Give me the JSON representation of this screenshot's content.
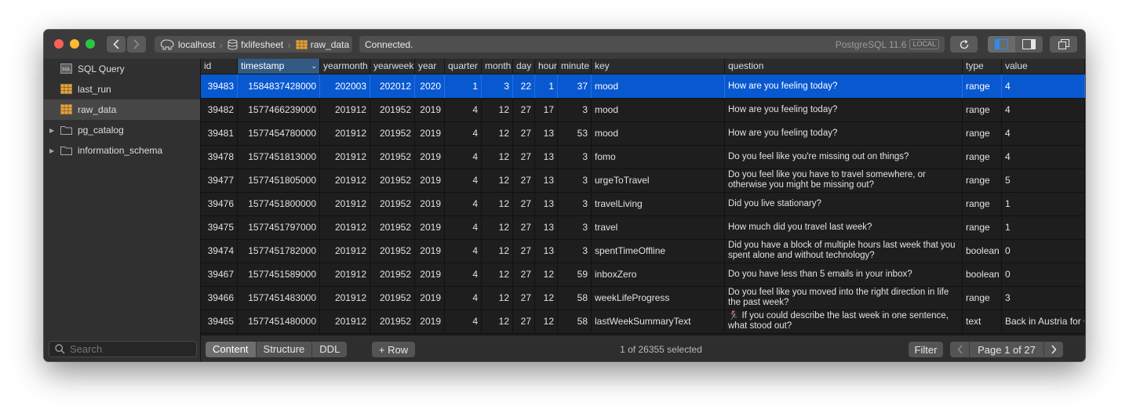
{
  "breadcrumbs": [
    "localhost",
    "fxlifesheet",
    "raw_data"
  ],
  "status_text": "Connected.",
  "db_label": "PostgreSQL 11.6",
  "db_badge": "LOCAL",
  "sidebar": {
    "items": [
      {
        "label": "SQL Query",
        "icon": "sql-file-icon"
      },
      {
        "label": "last_run",
        "icon": "table-icon"
      },
      {
        "label": "raw_data",
        "icon": "table-icon",
        "selected": true
      },
      {
        "label": "pg_catalog",
        "icon": "folder-icon"
      },
      {
        "label": "information_schema",
        "icon": "folder-icon"
      }
    ],
    "search_placeholder": "Search"
  },
  "columns": [
    "id",
    "timestamp",
    "yearmonth",
    "yearweek",
    "year",
    "quarter",
    "month",
    "day",
    "hour",
    "minute",
    "key",
    "question",
    "type",
    "value"
  ],
  "sorted_column": "timestamp",
  "rows": [
    [
      "39483",
      "1584837428000",
      "202003",
      "202012",
      "2020",
      "1",
      "3",
      "22",
      "1",
      "37",
      "mood",
      "How are you feeling today?",
      "range",
      "4"
    ],
    [
      "39482",
      "1577466239000",
      "201912",
      "201952",
      "2019",
      "4",
      "12",
      "27",
      "17",
      "3",
      "mood",
      "How are you feeling today?",
      "range",
      "4"
    ],
    [
      "39481",
      "1577454780000",
      "201912",
      "201952",
      "2019",
      "4",
      "12",
      "27",
      "13",
      "53",
      "mood",
      "How are you feeling today?",
      "range",
      "4"
    ],
    [
      "39478",
      "1577451813000",
      "201912",
      "201952",
      "2019",
      "4",
      "12",
      "27",
      "13",
      "3",
      "fomo",
      "Do you feel like you're missing out on things?",
      "range",
      "4"
    ],
    [
      "39477",
      "1577451805000",
      "201912",
      "201952",
      "2019",
      "4",
      "12",
      "27",
      "13",
      "3",
      "urgeToTravel",
      "Do you feel like you have to travel somewhere, or otherwise you might be missing out?",
      "range",
      "5"
    ],
    [
      "39476",
      "1577451800000",
      "201912",
      "201952",
      "2019",
      "4",
      "12",
      "27",
      "13",
      "3",
      "travelLiving",
      "Did you live stationary?",
      "range",
      "1"
    ],
    [
      "39475",
      "1577451797000",
      "201912",
      "201952",
      "2019",
      "4",
      "12",
      "27",
      "13",
      "3",
      "travel",
      "How much did you travel last week?",
      "range",
      "1"
    ],
    [
      "39474",
      "1577451782000",
      "201912",
      "201952",
      "2019",
      "4",
      "12",
      "27",
      "13",
      "3",
      "spentTimeOffline",
      "Did you have a block of multiple hours last week that you spent alone and without technology?",
      "boolean",
      "0"
    ],
    [
      "39467",
      "1577451589000",
      "201912",
      "201952",
      "2019",
      "4",
      "12",
      "27",
      "12",
      "59",
      "inboxZero",
      "Do you have less than 5 emails in your inbox?",
      "boolean",
      "0"
    ],
    [
      "39466",
      "1577451483000",
      "201912",
      "201952",
      "2019",
      "4",
      "12",
      "27",
      "12",
      "58",
      "weekLifeProgress",
      "Do you feel like you moved into the right direction in life the past week?",
      "range",
      "3"
    ],
    [
      "39465",
      "1577451480000",
      "201912",
      "201952",
      "2019",
      "4",
      "12",
      "27",
      "12",
      "58",
      "lastWeekSummaryText",
      "🏃‍♀️ If you could describe the last week in one sentence, what stood out?",
      "text",
      "Back in Austria for C"
    ]
  ],
  "selected_row": 0,
  "tabs": [
    {
      "label": "Content",
      "active": true
    },
    {
      "label": "Structure",
      "active": false
    },
    {
      "label": "DDL",
      "active": false
    }
  ],
  "add_row_label": "+ Row",
  "selection_count": "1 of 26355 selected",
  "filter_label": "Filter",
  "page_label": "Page 1 of 27"
}
